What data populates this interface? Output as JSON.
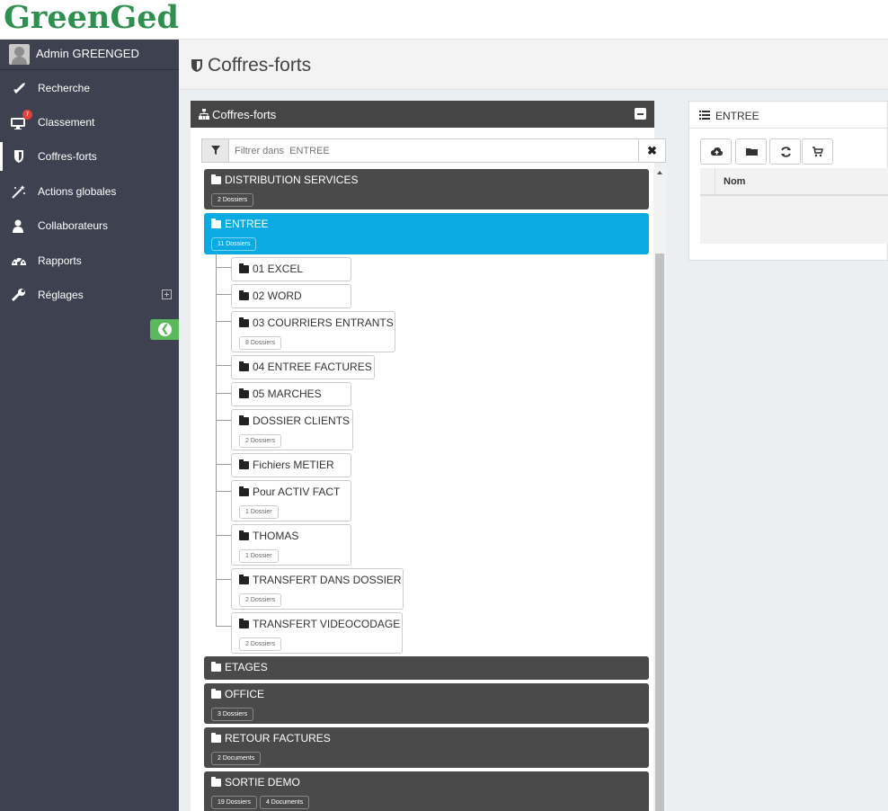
{
  "brand": {
    "logo": "GreenGed"
  },
  "user": {
    "name": "Admin GREENGED"
  },
  "sidebar": {
    "items": [
      {
        "label": "Recherche",
        "icon": "rocket-icon"
      },
      {
        "label": "Classement",
        "icon": "monitor-icon",
        "badge": "7"
      },
      {
        "label": "Coffres-forts",
        "icon": "shield-icon",
        "active": true
      },
      {
        "label": "Actions globales",
        "icon": "magic-wand-icon"
      },
      {
        "label": "Collaborateurs",
        "icon": "user-icon"
      },
      {
        "label": "Rapports",
        "icon": "dashboard-icon"
      },
      {
        "label": "Réglages",
        "icon": "wrench-icon"
      }
    ],
    "collapse_color": "#5cb85c"
  },
  "page": {
    "title": "Coffres-forts"
  },
  "tree_panel": {
    "title": "Coffres-forts",
    "filter_placeholder": "Filtrer dans  ENTREE",
    "filter_clear": "✖",
    "nodes": [
      {
        "label": "DISTRIBUTION SERVICES",
        "pills": [
          "2 Dossiers"
        ]
      },
      {
        "label": "ENTREE",
        "pills": [
          "11 Dossiers"
        ],
        "selected": true,
        "children": [
          {
            "label": "01 EXCEL"
          },
          {
            "label": "02 WORD"
          },
          {
            "label": "03 COURRIERS ENTRANTS",
            "pills": [
              "8 Dossiers"
            ]
          },
          {
            "label": "04 ENTREE FACTURES"
          },
          {
            "label": "05 MARCHES"
          },
          {
            "label": "DOSSIER CLIENTS",
            "pills": [
              "2 Dossiers"
            ]
          },
          {
            "label": "Fichiers METIER"
          },
          {
            "label": "Pour ACTIV FACT",
            "pills": [
              "1 Dossier"
            ]
          },
          {
            "label": "THOMAS",
            "pills": [
              "1 Dossier"
            ]
          },
          {
            "label": "TRANSFERT DANS DOSSIER",
            "pills": [
              "2 Dossiers"
            ]
          },
          {
            "label": "TRANSFERT VIDEOCODAGE",
            "pills": [
              "2 Dossiers"
            ]
          }
        ]
      },
      {
        "label": "ETAGES"
      },
      {
        "label": "OFFICE",
        "pills": [
          "3 Dossiers"
        ]
      },
      {
        "label": "RETOUR FACTURES",
        "pills": [
          "2 Documents"
        ]
      },
      {
        "label": "SORTIE DEMO",
        "pills": [
          "19 Dossiers",
          "4 Documents"
        ]
      }
    ],
    "selected_color": "#0aaae2",
    "node_color": "#4a4a4a"
  },
  "detail_panel": {
    "title": "ENTREE",
    "toolbar": [
      "upload-icon",
      "folder-icon",
      "refresh-icon",
      "cart-icon"
    ],
    "table": {
      "columns": [
        "Nom"
      ]
    }
  }
}
